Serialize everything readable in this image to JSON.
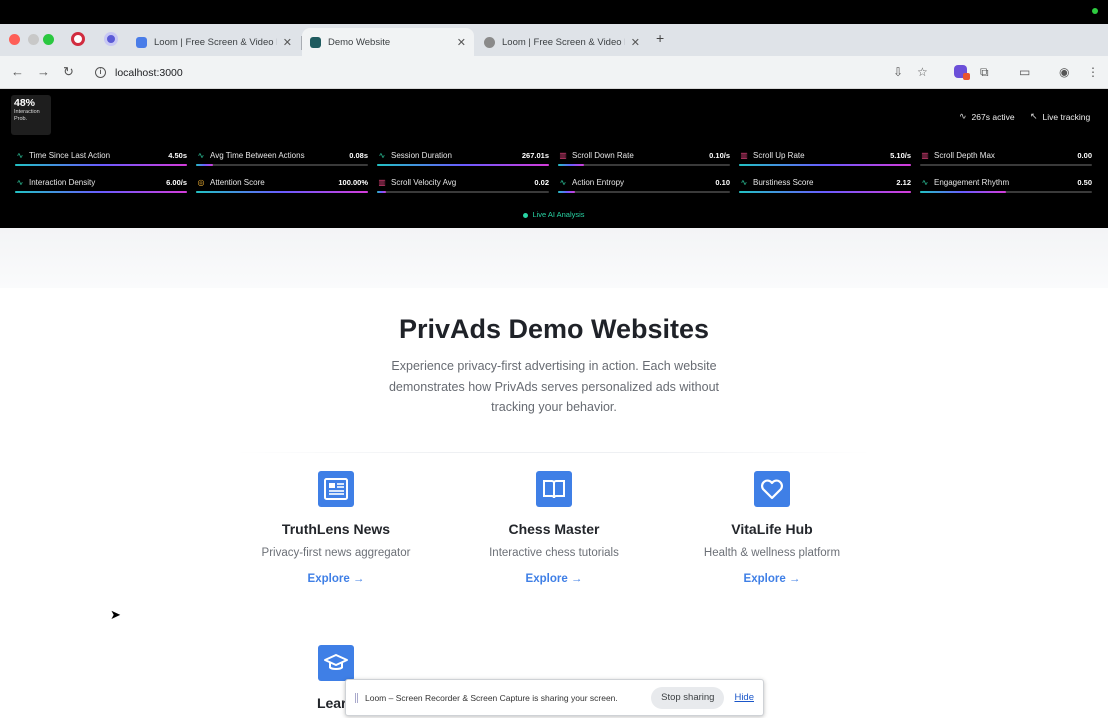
{
  "browser": {
    "tabs": [
      {
        "title": "Loom | Free Screen & Video Recording",
        "active": false,
        "favicon_color": "#4a7de8"
      },
      {
        "title": "Demo Website",
        "active": true,
        "favicon_color": "#1f5b5f"
      },
      {
        "title": "Loom | Free Screen & Video Recording",
        "active": false,
        "favicon_color": "#8a8a8a"
      }
    ],
    "new_tab_label": "+",
    "url": "localhost:3000"
  },
  "panel": {
    "prob_value": "48%",
    "prob_label": "Interaction Prob.",
    "active_text": "267s active",
    "tracking_text": "Live tracking",
    "metrics": [
      {
        "label": "Time Since Last Action",
        "value": "4.50s",
        "icon": "activity-icon",
        "fill": 1.0
      },
      {
        "label": "Avg Time Between Actions",
        "value": "0.08s",
        "icon": "activity-icon",
        "fill": 0.1
      },
      {
        "label": "Session Duration",
        "value": "267.01s",
        "icon": "activity-icon",
        "fill": 1.0
      },
      {
        "label": "Scroll Down Rate",
        "value": "0.10/s",
        "icon": "bar-chart-icon",
        "fill": 0.15
      },
      {
        "label": "Scroll Up Rate",
        "value": "5.10/s",
        "icon": "bar-chart-icon",
        "fill": 1.0
      },
      {
        "label": "Scroll Depth Max",
        "value": "0.00",
        "icon": "bar-chart-icon",
        "fill": 0.0
      },
      {
        "label": "Interaction Density",
        "value": "6.00/s",
        "icon": "activity-icon",
        "fill": 1.0
      },
      {
        "label": "Attention Score",
        "value": "100.00%",
        "icon": "eye-icon",
        "fill": 1.0
      },
      {
        "label": "Scroll Velocity Avg",
        "value": "0.02",
        "icon": "bar-chart-icon",
        "fill": 0.05
      },
      {
        "label": "Action Entropy",
        "value": "0.10",
        "icon": "activity-icon",
        "fill": 0.1
      },
      {
        "label": "Burstiness Score",
        "value": "2.12",
        "icon": "activity-icon",
        "fill": 1.0
      },
      {
        "label": "Engagement Rhythm",
        "value": "0.50",
        "icon": "activity-icon",
        "fill": 0.5
      }
    ],
    "ai_label": "Live AI Analysis"
  },
  "hero": {
    "title": "PrivAds Demo Websites",
    "subtitle": "Experience privacy-first advertising in action. Each website demonstrates how PrivAds serves personalized ads without tracking your behavior."
  },
  "cards": [
    {
      "name": "TruthLens News",
      "desc": "Privacy-first news aggregator",
      "link": "Explore →",
      "icon": "newspaper-icon"
    },
    {
      "name": "Chess Master",
      "desc": "Interactive chess tutorials",
      "link": "Explore →",
      "icon": "book-icon"
    },
    {
      "name": "VitaLife Hub",
      "desc": "Health & wellness platform",
      "link": "Explore →",
      "icon": "heart-icon"
    },
    {
      "name": "Learn",
      "desc": "",
      "link": "",
      "icon": "graduation-cap-icon"
    }
  ],
  "sharebar": {
    "message": "Loom – Screen Recorder & Screen Capture is sharing your screen.",
    "stop_label": "Stop sharing",
    "hide_label": "Hide"
  }
}
